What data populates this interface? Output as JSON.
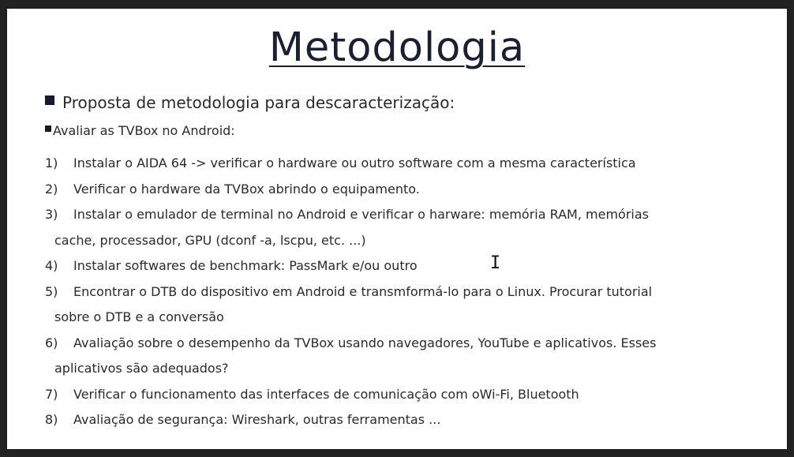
{
  "slide": {
    "title": "Metodologia",
    "heading": "Proposta de metodologia para descaracterização:",
    "subheading": "Avaliar as TVBox no Android:",
    "items": [
      {
        "num": "1)",
        "line1": "Instalar o AIDA 64 -> verificar o hardware ou outro software com a mesma característica",
        "line2": ""
      },
      {
        "num": "2)",
        "line1": "Verificar o hardware da TVBox abrindo o equipamento.",
        "line2": ""
      },
      {
        "num": "3)",
        "line1": "Instalar o emulador de terminal no Android e verificar o harware: memória RAM, memórias",
        "line2": "cache, processador, GPU (dconf -a, lscpu, etc. ...)"
      },
      {
        "num": "4)",
        "line1": "Instalar softwares de benchmark: PassMark e/ou outro",
        "line2": ""
      },
      {
        "num": "5)",
        "line1": "Encontrar o DTB do dispositivo em Android e transmformá-lo para o Linux. Procurar tutorial",
        "line2": "sobre o DTB e a conversão"
      },
      {
        "num": "6)",
        "line1": "Avaliação sobre o desempenho da TVBox usando navegadores, YouTube e aplicativos. Esses",
        "line2": "aplicativos são adequados?"
      },
      {
        "num": "7)",
        "line1": "Verificar o funcionamento das interfaces de comunicação com oWi-Fi, Bluetooth",
        "line2": ""
      },
      {
        "num": "8)",
        "line1": "Avaliação de segurança: Wireshark, outras ferramentas ...",
        "line2": ""
      }
    ]
  },
  "cursor": {
    "icon": "text-cursor-icon",
    "glyph": "I"
  },
  "colors": {
    "title": "#1b1f33",
    "bullet": "#141a33",
    "text": "#2a2a2a",
    "background": "#ffffff"
  }
}
